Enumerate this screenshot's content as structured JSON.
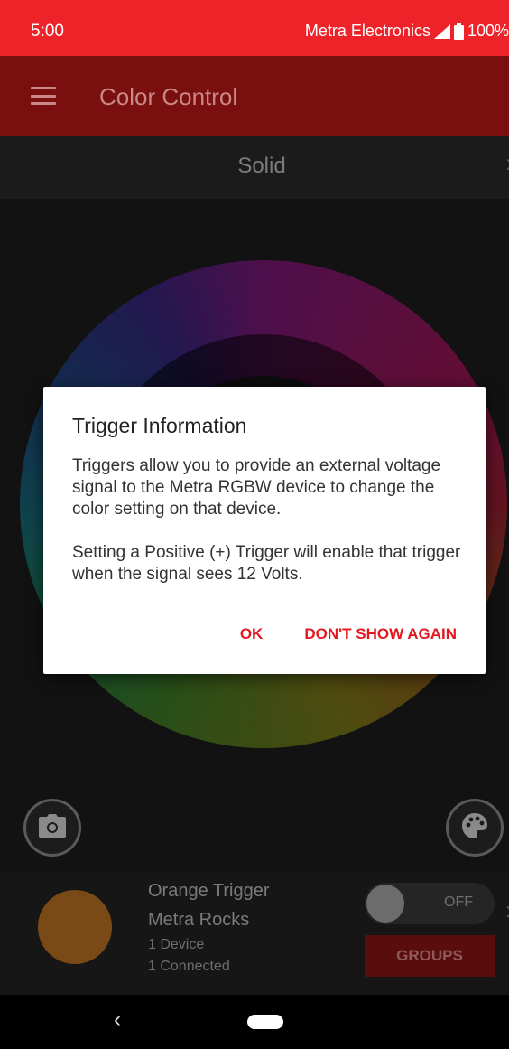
{
  "status_bar": {
    "time": "5:00",
    "carrier": "Metra Electronics",
    "battery": "100%",
    "icons": [
      "signal-icon",
      "battery-icon"
    ]
  },
  "app_bar": {
    "title": "Color Control",
    "menu_icon": "menu-icon"
  },
  "mode": {
    "label": "Solid",
    "next_icon": "chevron-right-icon"
  },
  "tools": {
    "left_icon": "camera-icon",
    "right_icon": "palette-icon"
  },
  "trigger_panel": {
    "trigger_name": "Orange Trigger",
    "group_name": "Metra Rocks",
    "devices": "1 Device",
    "connected": "1 Connected",
    "toggle_label": "OFF",
    "toggle_on": false,
    "groups_button": "GROUPS",
    "dot_color": "#7a4a16"
  },
  "dialog": {
    "title": "Trigger Information",
    "paragraph1": "Triggers allow you to provide an external voltage signal to the Metra RGBW device to change the color setting on that device.",
    "paragraph2": "Setting a Positive (+) Trigger will enable that trigger when the signal sees 12 Volts.",
    "ok_label": "OK",
    "dont_show_label": "DON'T SHOW AGAIN"
  },
  "nav_bar": {
    "back_icon": "back-icon",
    "home_icon": "home-pill-icon"
  },
  "colors": {
    "status_bar": "#ee2229",
    "app_bar": "#7a0f0f",
    "accent": "#e3191f"
  }
}
